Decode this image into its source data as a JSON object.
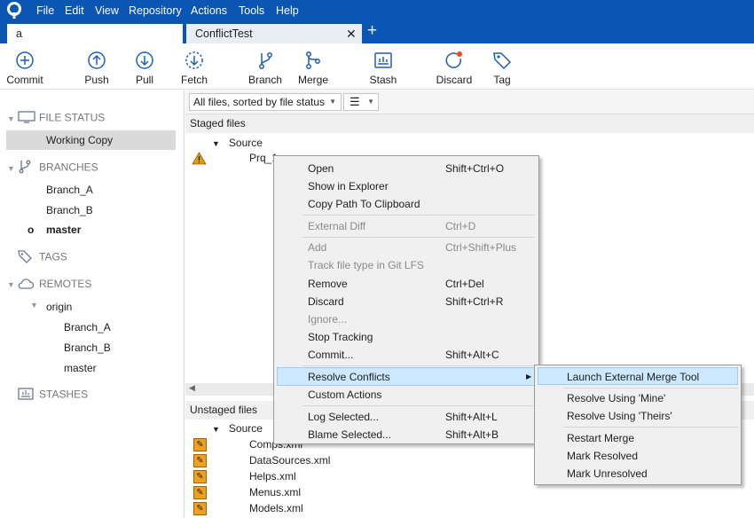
{
  "menubar": {
    "items": [
      "File",
      "Edit",
      "View",
      "Repository",
      "Actions",
      "Tools",
      "Help"
    ]
  },
  "tabs": [
    {
      "label": "a"
    },
    {
      "label": "ConflictTest",
      "close": "✕"
    }
  ],
  "tab_add": "+",
  "toolbar": {
    "commit": "Commit",
    "push": "Push",
    "pull": "Pull",
    "fetch": "Fetch",
    "branch": "Branch",
    "merge": "Merge",
    "stash": "Stash",
    "discard": "Discard",
    "tag": "Tag"
  },
  "sidebar": {
    "file_status": "FILE STATUS",
    "working_copy": "Working Copy",
    "branches": "BRANCHES",
    "branch_items": [
      "Branch_A",
      "Branch_B",
      "master"
    ],
    "current_branch_marker": "o",
    "tags": "TAGS",
    "remotes": "REMOTES",
    "remote_name": "origin",
    "remote_items": [
      "Branch_A",
      "Branch_B",
      "master"
    ],
    "stashes": "STASHES"
  },
  "filter": {
    "sort": "All files, sorted by file status",
    "view_icon": "list-icon"
  },
  "staged": {
    "header": "Staged files",
    "source": "Source",
    "file": "Prq_1"
  },
  "unstaged": {
    "header": "Unstaged files",
    "source": "Source",
    "files": [
      "Comps.xml",
      "DataSources.xml",
      "Helps.xml",
      "Menus.xml",
      "Models.xml"
    ]
  },
  "context_menu": {
    "open": {
      "label": "Open",
      "shortcut": "Shift+Ctrl+O"
    },
    "show_explorer": {
      "label": "Show in Explorer"
    },
    "copy_path": {
      "label": "Copy Path To Clipboard"
    },
    "external_diff": {
      "label": "External Diff",
      "shortcut": "Ctrl+D"
    },
    "add": {
      "label": "Add",
      "shortcut": "Ctrl+Shift+Plus"
    },
    "track_lfs": {
      "label": "Track file type in Git LFS"
    },
    "remove": {
      "label": "Remove",
      "shortcut": "Ctrl+Del"
    },
    "discard": {
      "label": "Discard",
      "shortcut": "Shift+Ctrl+R"
    },
    "ignore": {
      "label": "Ignore..."
    },
    "stop_tracking": {
      "label": "Stop Tracking"
    },
    "commit": {
      "label": "Commit...",
      "shortcut": "Shift+Alt+C"
    },
    "resolve_conflicts": {
      "label": "Resolve Conflicts",
      "arrow": "▶"
    },
    "custom_actions": {
      "label": "Custom Actions"
    },
    "log_selected": {
      "label": "Log Selected...",
      "shortcut": "Shift+Alt+L"
    },
    "blame_selected": {
      "label": "Blame Selected...",
      "shortcut": "Shift+Alt+B"
    }
  },
  "submenu": {
    "launch_merge": "Launch External Merge Tool",
    "resolve_mine": "Resolve Using 'Mine'",
    "resolve_theirs": "Resolve Using 'Theirs'",
    "restart_merge": "Restart Merge",
    "mark_resolved": "Mark Resolved",
    "mark_unresolved": "Mark Unresolved"
  },
  "colors": {
    "titlebar": "#0b55b3",
    "toolbar_icon": "#1f5fb4",
    "conflict_warning": "#e8a000",
    "modified_badge": "#f0a020",
    "menu_highlight": "#cde8ff"
  }
}
